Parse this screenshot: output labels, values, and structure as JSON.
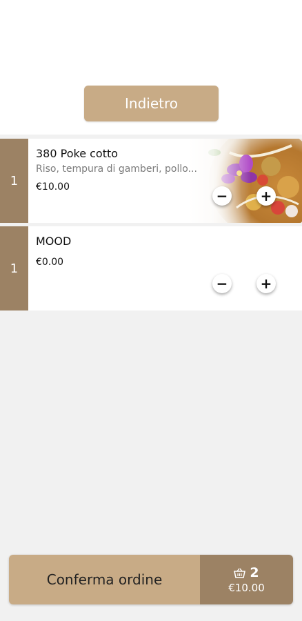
{
  "header": {
    "back_label": "Indietro"
  },
  "cart_items": [
    {
      "qty": "1",
      "name": "380 Poke cotto",
      "description": "Riso, tempura di gamberi, pollo...",
      "price": "€10.00",
      "image": "poke-bowl-photo",
      "minus_icon": "minus-icon",
      "plus_icon": "plus-icon"
    },
    {
      "qty": "1",
      "name": "MOOD",
      "price": "€0.00",
      "minus_icon": "minus-icon",
      "plus_icon": "plus-icon"
    }
  ],
  "footer": {
    "confirm_label": "Conferma ordine",
    "basket_icon": "basket-icon",
    "cart_count": "2",
    "cart_total": "€10.00"
  },
  "colors": {
    "accent_light": "#c8ab86",
    "accent_dark": "#9c8264",
    "background": "#f1f1f1"
  }
}
